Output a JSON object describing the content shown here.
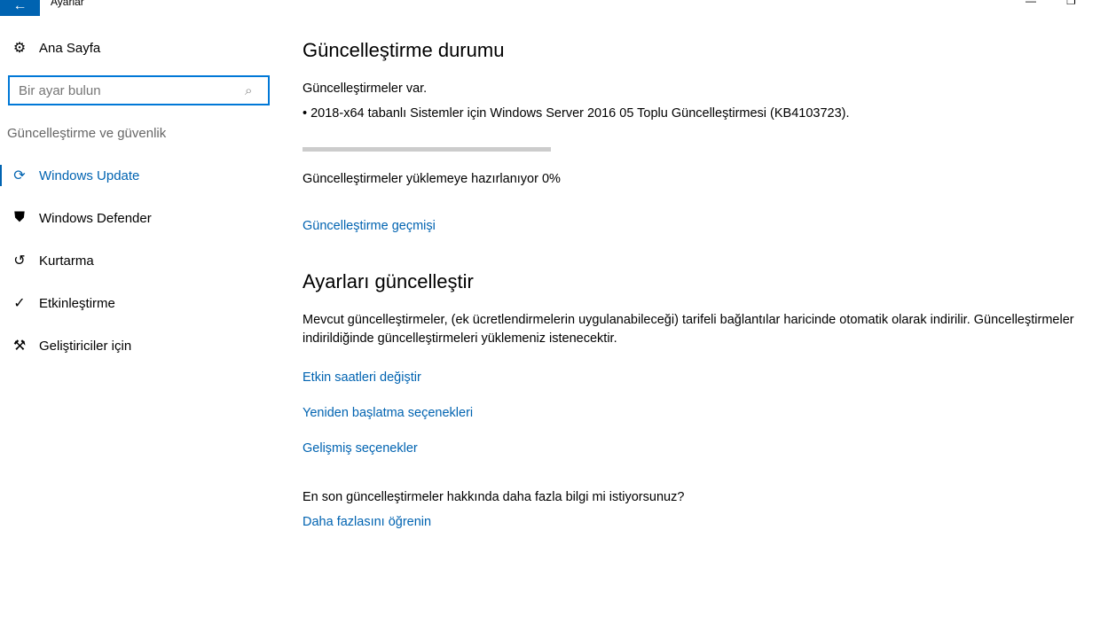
{
  "window": {
    "title": "Ayarlar",
    "back_icon": "arrow-left-icon",
    "minimize": "—",
    "restore": "❐"
  },
  "sidebar": {
    "home": "Ana Sayfa",
    "search_placeholder": "Bir ayar bulun",
    "section": "Güncelleştirme ve güvenlik",
    "items": [
      {
        "label": "Windows Update",
        "icon": "⟳"
      },
      {
        "label": "Windows Defender",
        "icon": "⛊"
      },
      {
        "label": "Kurtarma",
        "icon": "↺"
      },
      {
        "label": "Etkinleştirme",
        "icon": "✓"
      },
      {
        "label": "Geliştiriciler için",
        "icon": "⚒"
      }
    ]
  },
  "main": {
    "status_title": "Güncelleştirme durumu",
    "available": "Güncelleştirmeler var.",
    "update_item": "• 2018-x64 tabanlı Sistemler için Windows Server 2016 05 Toplu Güncelleştirmesi (KB4103723).",
    "progress_percent": 0,
    "progress_text": "Güncelleştirmeler yüklemeye hazırlanıyor 0%",
    "history_link": "Güncelleştirme geçmişi",
    "settings_title": "Ayarları güncelleştir",
    "settings_desc_1": "Mevcut güncelleştirmeler, (ek ücretlendirmelerin uygulanabileceği) tarifeli bağlantılar haricinde otomatik olarak indirilir. Güncelleştirmeler",
    "settings_desc_2": "indirildiğinde güncelleştirmeleri yüklemeniz istenecektir.",
    "links": [
      "Etkin saatleri değiştir",
      "Yeniden başlatma seçenekleri",
      "Gelişmiş seçenekler"
    ],
    "more_q": "En son güncelleştirmeler hakkında daha fazla bilgi mi istiyorsunuz?",
    "more_link": "Daha fazlasını öğrenin"
  }
}
